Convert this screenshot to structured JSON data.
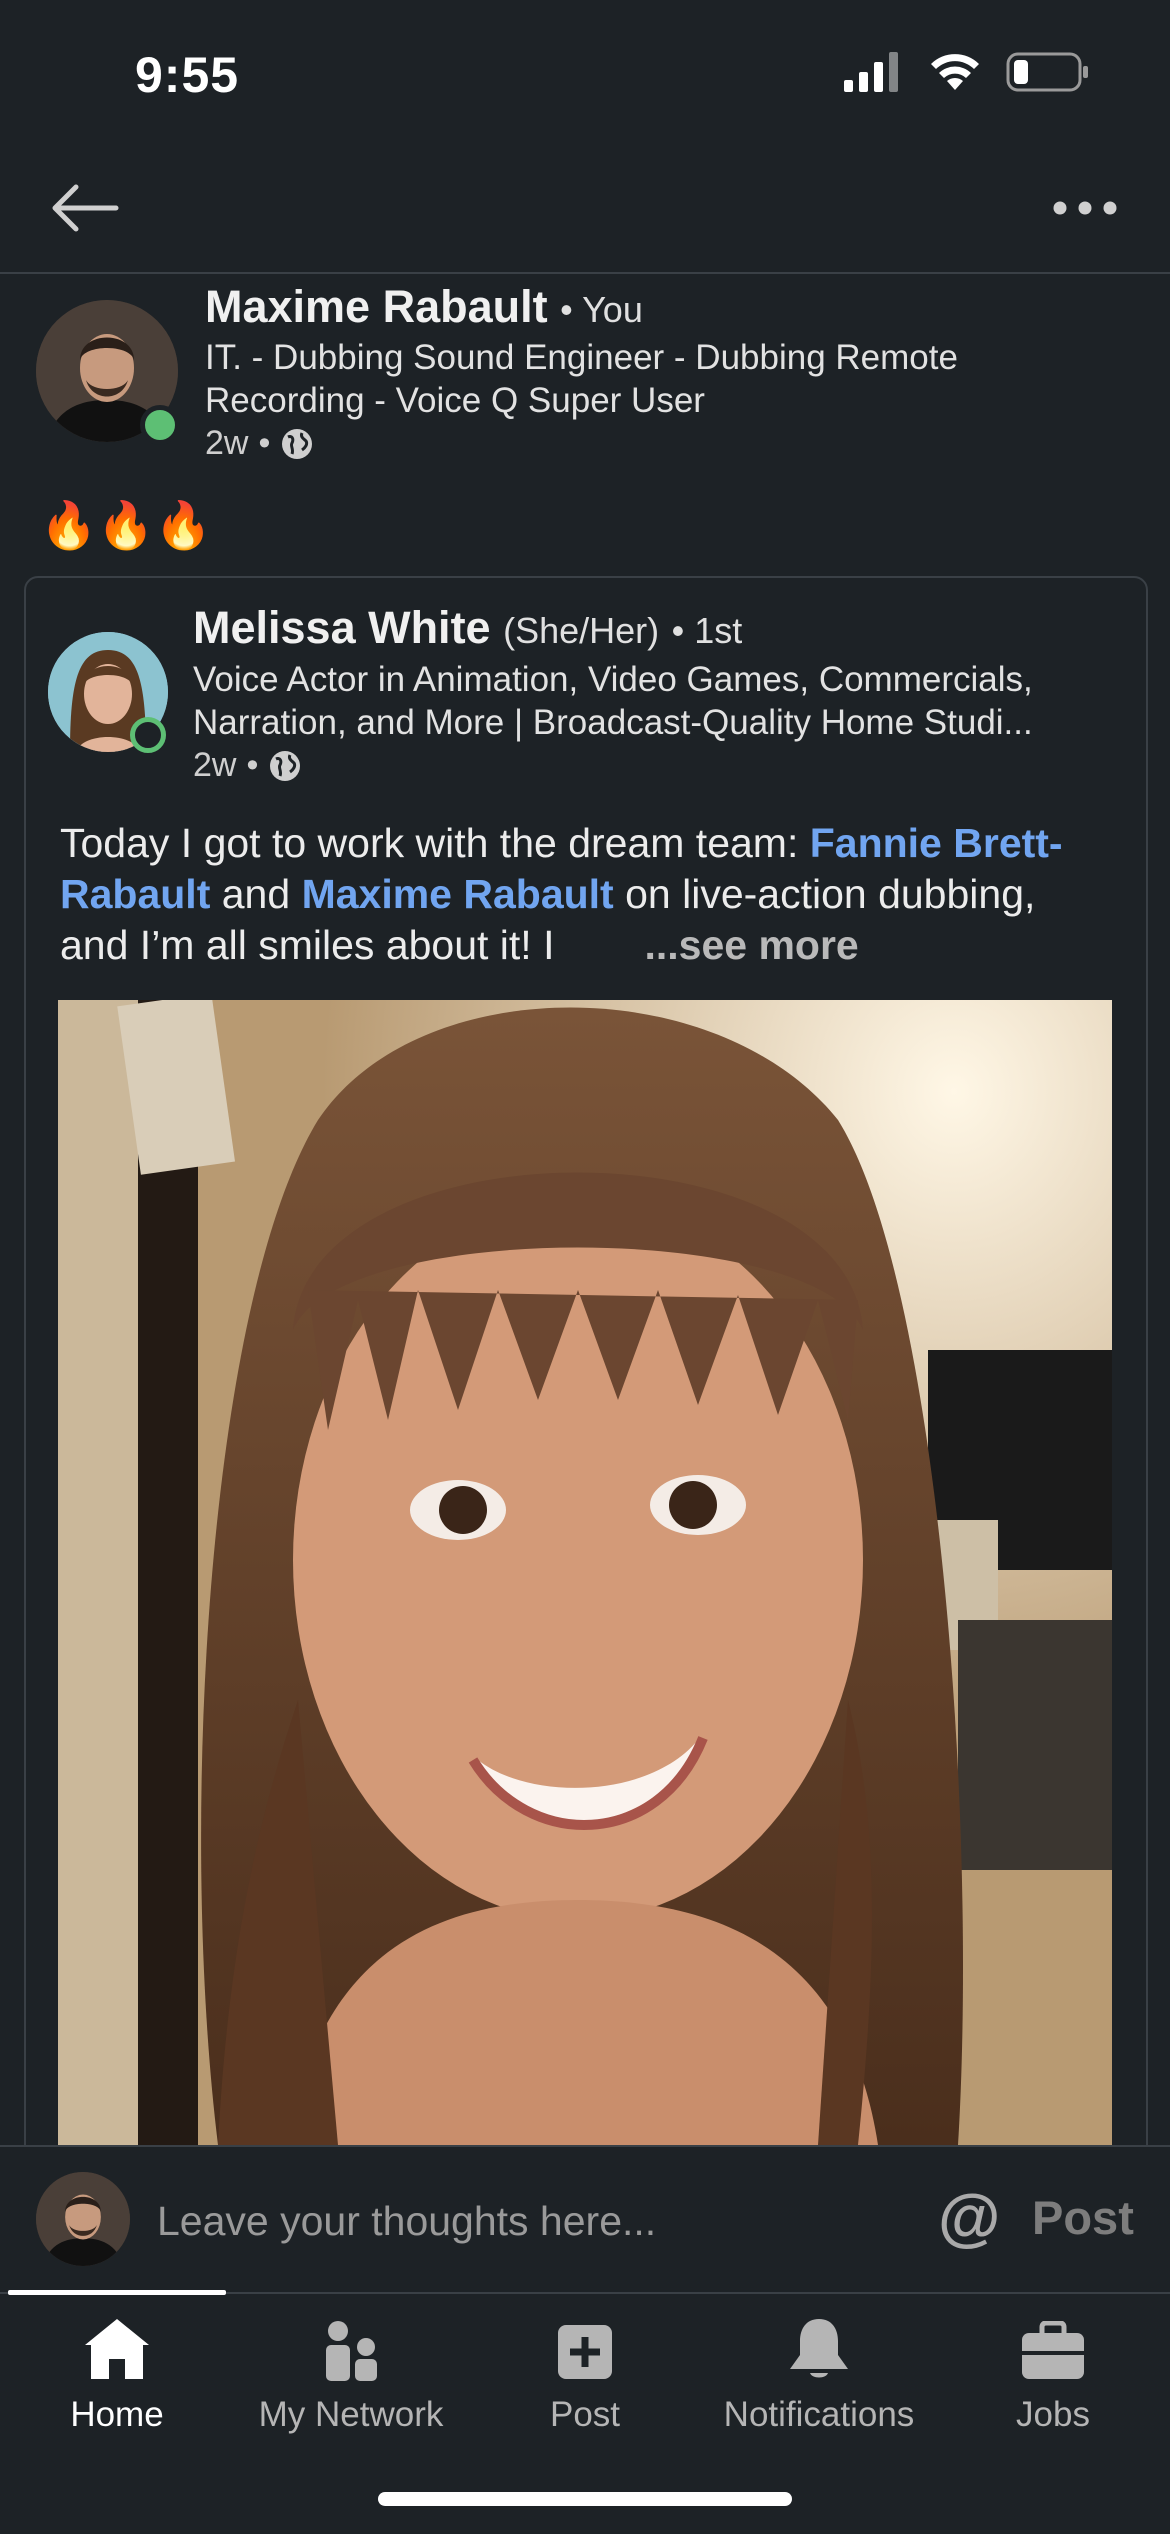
{
  "status_bar": {
    "time": "9:55"
  },
  "repost": {
    "author_name": "Maxime Rabault",
    "author_tag": "You",
    "headline": "IT. - Dubbing Sound Engineer - Dubbing Remote Recording - Voice Q Super User",
    "time_ago": "2w",
    "comment_text": "🔥🔥🔥"
  },
  "original_post": {
    "author_name": "Melissa White",
    "pronouns": "(She/Her)",
    "degree": "1st",
    "headline": "Voice Actor in Animation, Video Games, Commercials, Narration, and More | Broadcast-Quality Home Studi...",
    "time_ago": "2w",
    "text_before": "Today I got to work with the dream team: ",
    "mention_1": "Fannie Brett-Rabault",
    "text_mid": " and ",
    "mention_2": "Maxime Rabault",
    "text_after": " on live-action dubbing, and I’m all smiles about it! I",
    "see_more": "...see more"
  },
  "comment_bar": {
    "placeholder": "Leave your thoughts here...",
    "mention_symbol": "@",
    "post_label": "Post"
  },
  "tabs": [
    {
      "label": "Home",
      "icon": "home-icon",
      "active": true
    },
    {
      "label": "My Network",
      "icon": "network-icon",
      "active": false
    },
    {
      "label": "Post",
      "icon": "post-plus-icon",
      "active": false
    },
    {
      "label": "Notifications",
      "icon": "bell-icon",
      "active": false
    },
    {
      "label": "Jobs",
      "icon": "briefcase-icon",
      "active": false
    }
  ],
  "colors": {
    "background": "#1d2226",
    "link": "#71a5f0",
    "online": "#5dbf74",
    "divider": "#3a4046"
  }
}
